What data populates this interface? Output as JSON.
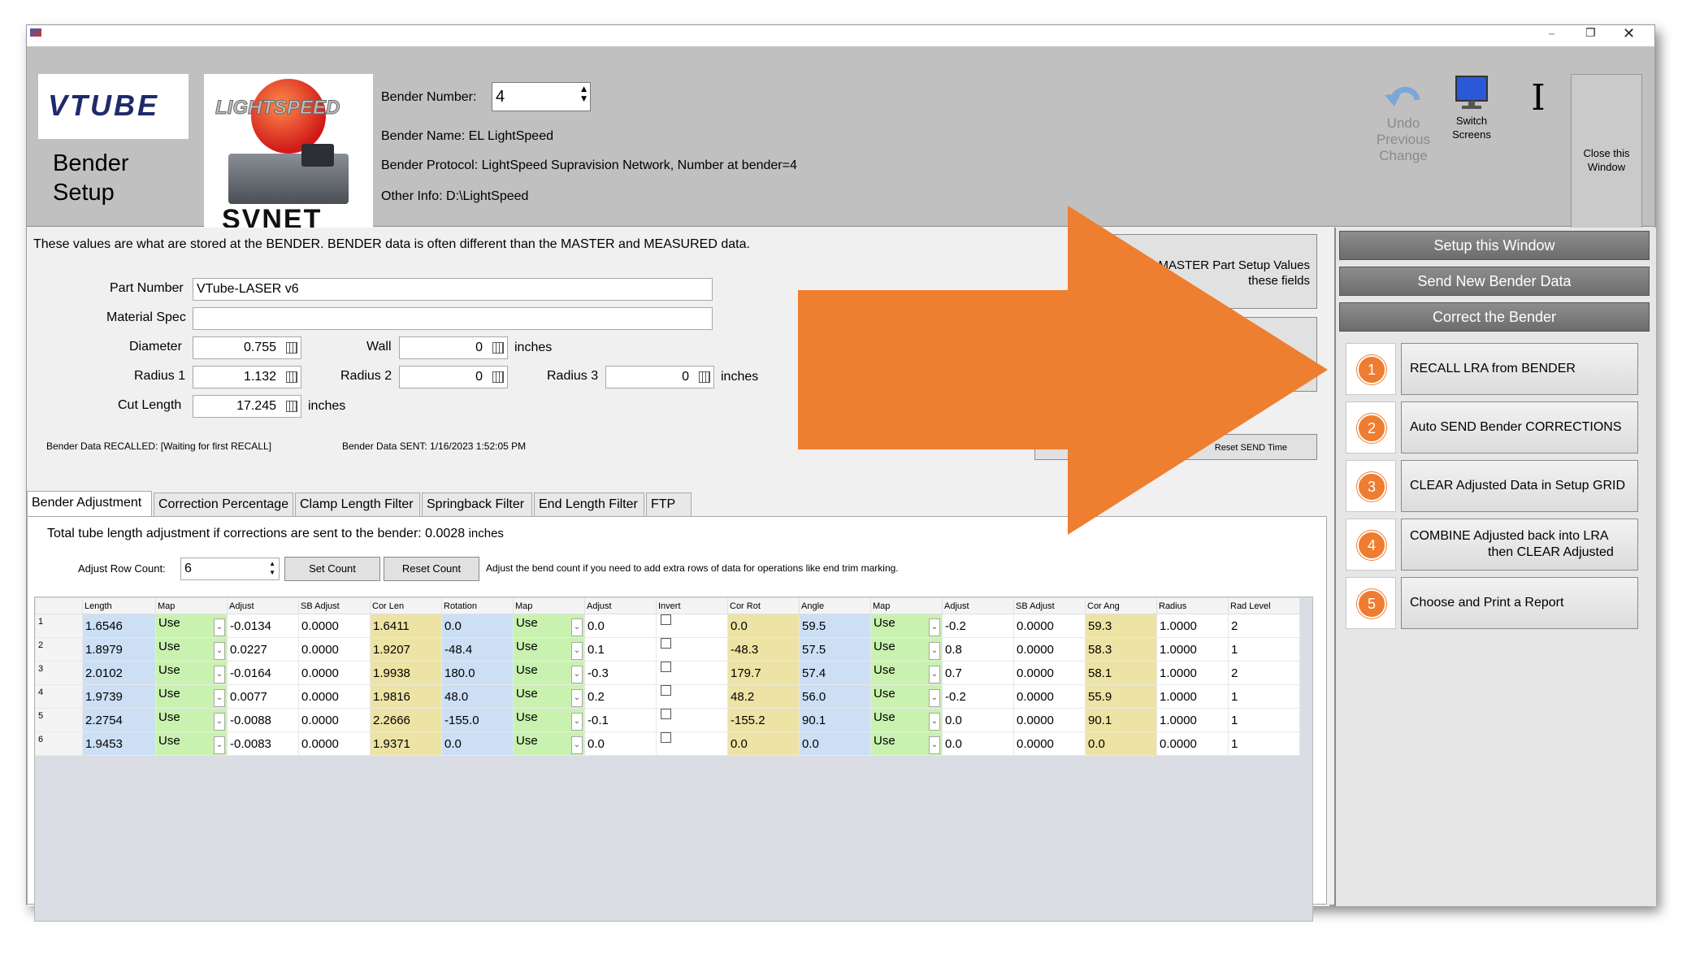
{
  "window": {
    "title_controls": {
      "minimize": "–",
      "restore": "❐",
      "close": "✕"
    }
  },
  "header": {
    "logo_text_a": "V",
    "logo_text_b": "TUBE",
    "page_title_line1": "Bender",
    "page_title_line2": "Setup",
    "svnet_logo_top": "LIGHTSPEED",
    "svnet_logo_bottom": "SVNET",
    "bender_number_label": "Bender Number:",
    "bender_number_value": "4",
    "bender_name": "Bender Name: EL LightSpeed",
    "bender_protocol": "Bender Protocol: LightSpeed Supravision Network, Number at bender=4",
    "other_info": "Other Info: D:\\LightSpeed",
    "toolbar": {
      "undo_label_1": "Undo",
      "undo_label_2": "Previous",
      "undo_label_3": "Change",
      "switch_label_1": "Switch",
      "switch_label_2": "Screens",
      "cursor_glyph": "I",
      "close_label_1": "Close this",
      "close_label_2": "Window"
    }
  },
  "main": {
    "info_text": "These values are what are stored at the BENDER.  BENDER data is often different than the MASTER and MEASURED data.",
    "partial_button_line1": "MASTER Part Setup Values",
    "partial_button_line2": "these fields",
    "reset_send_time": "Reset SEND Time",
    "fields": {
      "part_number_label": "Part Number",
      "part_number_value": "VTube-LASER v6",
      "material_spec_label": "Material Spec",
      "material_spec_value": "",
      "diameter_label": "Diameter",
      "diameter_value": "0.755",
      "wall_label": "Wall",
      "wall_value": "0",
      "radius1_label": "Radius 1",
      "radius1_value": "1.132",
      "radius2_label": "Radius 2",
      "radius2_value": "0",
      "radius3_label": "Radius 3",
      "radius3_value": "0",
      "cut_length_label": "Cut Length",
      "cut_length_value": "17.245",
      "units": "inches"
    },
    "recalled_status": "Bender Data RECALLED:  [Waiting for first RECALL]",
    "sent_status": "Bender Data SENT:  1/16/2023 1:52:05 PM",
    "tabs": [
      "Bender Adjustment",
      "Correction Percentage",
      "Clamp Length Filter",
      "Springback Filter",
      "End Length Filter",
      "FTP"
    ],
    "adjustment_text": "Total tube length adjustment if corrections are sent to the bender: 0.0028",
    "adjustment_units": "inches",
    "row_count_label": "Adjust Row Count:",
    "row_count_value": "6",
    "set_count": "Set Count",
    "reset_count": "Reset Count",
    "row_count_hint": "Adjust the bend count if you need to add extra rows of data for operations like end trim marking.",
    "grid": {
      "headers": [
        "",
        "Length",
        "Map",
        "Adjust",
        "SB Adjust",
        "Cor Len",
        "Rotation",
        "Map",
        "Adjust",
        "Invert",
        "Cor Rot",
        "Angle",
        "Map",
        "Adjust",
        "SB Adjust",
        "Cor Ang",
        "Radius",
        "Rad Level"
      ],
      "rows": [
        [
          "1",
          "1.6546",
          "Use",
          "-0.0134",
          "0.0000",
          "1.6411",
          "0.0",
          "Use",
          "0.0",
          "",
          "0.0",
          "59.5",
          "Use",
          "-0.2",
          "0.0000",
          "59.3",
          "1.0000",
          "2"
        ],
        [
          "2",
          "1.8979",
          "Use",
          "0.0227",
          "0.0000",
          "1.9207",
          "-48.4",
          "Use",
          "0.1",
          "",
          "-48.3",
          "57.5",
          "Use",
          "0.8",
          "0.0000",
          "58.3",
          "1.0000",
          "1"
        ],
        [
          "3",
          "2.0102",
          "Use",
          "-0.0164",
          "0.0000",
          "1.9938",
          "180.0",
          "Use",
          "-0.3",
          "",
          "179.7",
          "57.4",
          "Use",
          "0.7",
          "0.0000",
          "58.1",
          "1.0000",
          "2"
        ],
        [
          "4",
          "1.9739",
          "Use",
          "0.0077",
          "0.0000",
          "1.9816",
          "48.0",
          "Use",
          "0.2",
          "",
          "48.2",
          "56.0",
          "Use",
          "-0.2",
          "0.0000",
          "55.9",
          "1.0000",
          "1"
        ],
        [
          "5",
          "2.2754",
          "Use",
          "-0.0088",
          "0.0000",
          "2.2666",
          "-155.0",
          "Use",
          "-0.1",
          "",
          "-155.2",
          "90.1",
          "Use",
          "0.0",
          "0.0000",
          "90.1",
          "1.0000",
          "1"
        ],
        [
          "6",
          "1.9453",
          "Use",
          "-0.0083",
          "0.0000",
          "1.9371",
          "0.0",
          "Use",
          "0.0",
          "",
          "0.0",
          "0.0",
          "Use",
          "0.0",
          "0.0000",
          "0.0",
          "0.0000",
          "1"
        ]
      ]
    }
  },
  "sidebar": {
    "setup_window": "Setup this Window",
    "send_new": "Send New Bender Data",
    "correct": "Correct the Bender",
    "steps": [
      {
        "num": "1",
        "label": "RECALL LRA from BENDER"
      },
      {
        "num": "2",
        "label": "Auto SEND Bender CORRECTIONS"
      },
      {
        "num": "3",
        "label": "CLEAR Adjusted Data in Setup GRID"
      },
      {
        "num": "4",
        "label": "COMBINE Adjusted back into LRA",
        "label2": "then CLEAR Adjusted"
      },
      {
        "num": "5",
        "label": "Choose and Print a Report"
      }
    ]
  },
  "colors": {
    "accent_orange": "#ef7d31",
    "length_blue": "#ccdff5",
    "map_green": "#c9f2b0",
    "cor_yellow": "#ede3a4"
  }
}
